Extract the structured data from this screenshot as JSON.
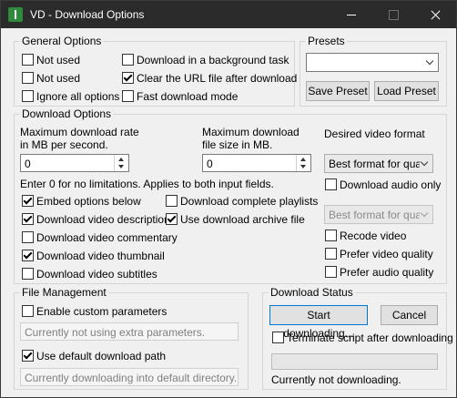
{
  "window": {
    "title": "VD - Download Options"
  },
  "general": {
    "label": "General Options",
    "not_used_1": "Not used",
    "not_used_2": "Not used",
    "ignore_all": "Ignore all options",
    "background_task": "Download in a background task",
    "clear_url": "Clear the URL file after download",
    "fast_mode": "Fast download mode"
  },
  "presets": {
    "label": "Presets",
    "selected": "",
    "save": "Save Preset",
    "load": "Load Preset"
  },
  "download_options": {
    "label": "Download Options",
    "rate_label_1": "Maximum download rate",
    "rate_label_2": "in MB per second.",
    "rate_value": "0",
    "size_label_1": "Maximum download",
    "size_label_2": "file size in MB.",
    "size_value": "0",
    "hint": "Enter 0 for no limitations. Applies to both input fields.",
    "video_format_label": "Desired video format",
    "video_format_value": "Best format for qualit",
    "audio_only": "Download audio only",
    "audio_format_value": "Best format for qualit",
    "embed": "Embed options below",
    "description": "Download video description",
    "commentary": "Download video commentary",
    "thumbnail": "Download video thumbnail",
    "subtitles": "Download video subtitles",
    "playlists": "Download complete playlists",
    "archive": "Use download archive file",
    "recode": "Recode video",
    "prefer_video": "Prefer video quality",
    "prefer_audio": "Prefer audio quality"
  },
  "file_management": {
    "label": "File Management",
    "custom_params": "Enable custom parameters",
    "params_placeholder": "Currently not using extra parameters.",
    "default_path": "Use default download path",
    "path_placeholder": "Currently downloading into default directory."
  },
  "status": {
    "label": "Download Status",
    "start": "Start downloading...",
    "cancel": "Cancel",
    "terminate": "Terminate script after downloading",
    "status_text": "Currently not downloading."
  }
}
